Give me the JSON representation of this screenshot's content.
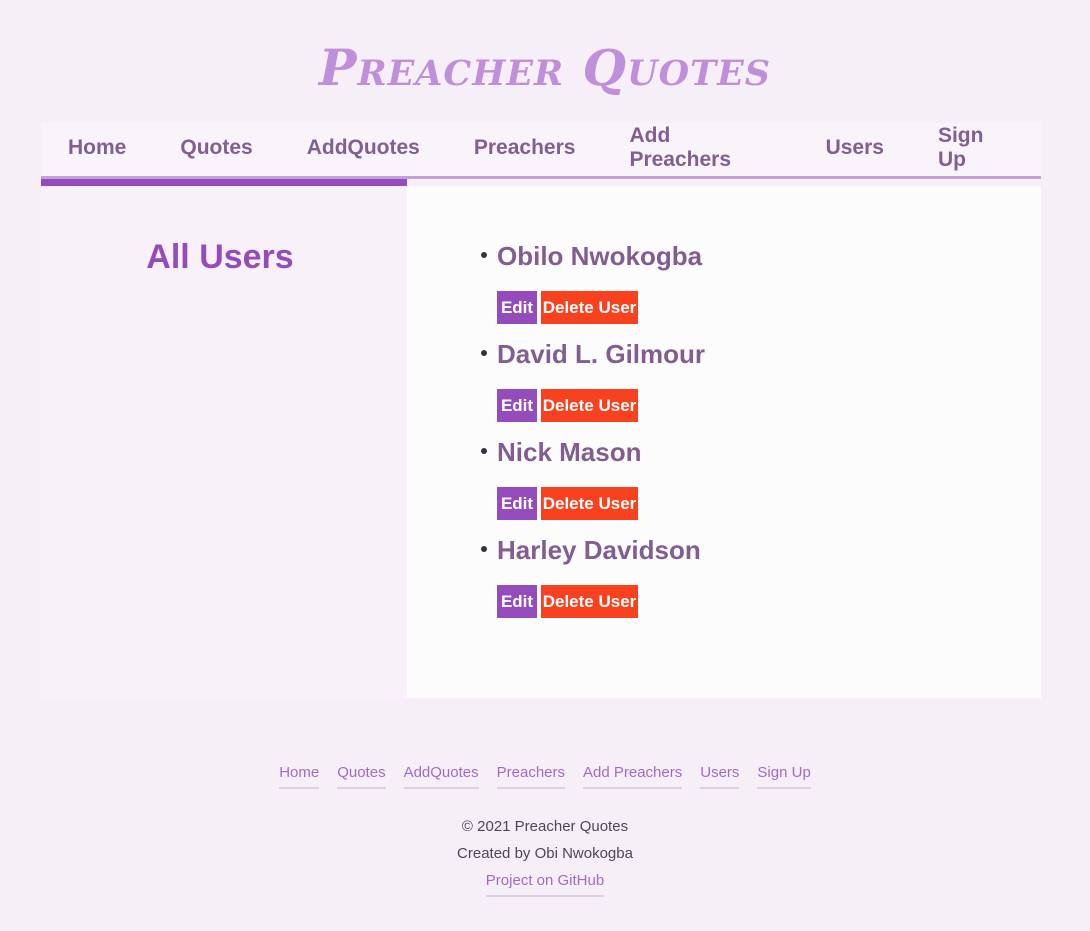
{
  "site": {
    "title": "Preacher Quotes"
  },
  "nav": {
    "items": [
      "Home",
      "Quotes",
      "AddQuotes",
      "Preachers",
      "Add Preachers",
      "Users",
      "Sign Up"
    ]
  },
  "page": {
    "heading": "All Users"
  },
  "users": [
    {
      "name": "Obilo Nwokogba"
    },
    {
      "name": "David L. Gilmour"
    },
    {
      "name": "Nick Mason"
    },
    {
      "name": "Harley Davidson"
    }
  ],
  "actions": {
    "edit_label": "Edit",
    "delete_label": "Delete User"
  },
  "footer": {
    "nav": [
      "Home",
      "Quotes",
      "AddQuotes",
      "Preachers",
      "Add Preachers",
      "Users",
      "Sign Up"
    ],
    "copyright": "© 2021 Preacher Quotes",
    "created_by": "Created by Obi Nwokogba",
    "github_label": "Project on GitHub"
  },
  "colors": {
    "accent": "#944cbd",
    "danger": "#f8421f",
    "background": "#f7eff8",
    "title": "#c08fdb"
  }
}
